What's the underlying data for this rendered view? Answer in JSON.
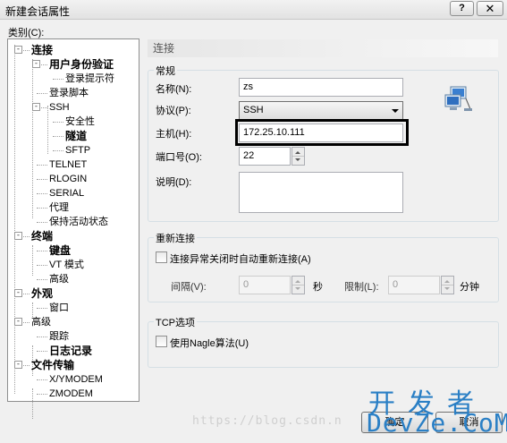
{
  "window": {
    "title": "新建会话属性",
    "help_label": "?",
    "close_label": "✕"
  },
  "category_label": "类别(C):",
  "tree": [
    {
      "label": "连接",
      "bold": true,
      "level": 0,
      "expander": "-"
    },
    {
      "label": "用户身份验证",
      "bold": true,
      "level": 1,
      "expander": "-"
    },
    {
      "label": "登录提示符",
      "bold": false,
      "level": 2
    },
    {
      "label": "登录脚本",
      "bold": false,
      "level": 1
    },
    {
      "label": "SSH",
      "bold": false,
      "level": 1,
      "expander": "-"
    },
    {
      "label": "安全性",
      "bold": false,
      "level": 2
    },
    {
      "label": "隧道",
      "bold": true,
      "level": 2
    },
    {
      "label": "SFTP",
      "bold": false,
      "level": 2
    },
    {
      "label": "TELNET",
      "bold": false,
      "level": 1
    },
    {
      "label": "RLOGIN",
      "bold": false,
      "level": 1
    },
    {
      "label": "SERIAL",
      "bold": false,
      "level": 1
    },
    {
      "label": "代理",
      "bold": false,
      "level": 1
    },
    {
      "label": "保持活动状态",
      "bold": false,
      "level": 1
    },
    {
      "label": "终端",
      "bold": true,
      "level": 0,
      "expander": "-"
    },
    {
      "label": "键盘",
      "bold": true,
      "level": 1
    },
    {
      "label": "VT 模式",
      "bold": false,
      "level": 1
    },
    {
      "label": "高级",
      "bold": false,
      "level": 1
    },
    {
      "label": "外观",
      "bold": true,
      "level": 0,
      "expander": "-"
    },
    {
      "label": "窗口",
      "bold": false,
      "level": 1
    },
    {
      "label": "高级",
      "bold": false,
      "level": 0,
      "expander": "-"
    },
    {
      "label": "跟踪",
      "bold": false,
      "level": 1
    },
    {
      "label": "日志记录",
      "bold": true,
      "level": 1
    },
    {
      "label": "文件传输",
      "bold": true,
      "level": 0,
      "expander": "-"
    },
    {
      "label": "X/YMODEM",
      "bold": false,
      "level": 1
    },
    {
      "label": "ZMODEM",
      "bold": false,
      "level": 1
    }
  ],
  "panel": {
    "header": "连接",
    "general": {
      "title": "常规",
      "name_label": "名称(N):",
      "name_value": "zs",
      "protocol_label": "协议(P):",
      "protocol_value": "SSH",
      "host_label": "主机(H):",
      "host_value": "172.25.10.111",
      "port_label": "端口号(O):",
      "port_value": "22",
      "desc_label": "说明(D):",
      "desc_value": ""
    },
    "reconnect": {
      "title": "重新连接",
      "auto_label": "连接异常关闭时自动重新连接(A)",
      "auto_checked": false,
      "interval_label": "间隔(V):",
      "interval_value": "0",
      "seconds_label": "秒",
      "limit_label": "限制(L):",
      "limit_value": "0",
      "minutes_label": "分钟"
    },
    "tcp": {
      "title": "TCP选项",
      "nagle_label": "使用Nagle算法(U)",
      "nagle_checked": false
    }
  },
  "buttons": {
    "ok": "确定",
    "cancel": "取消"
  },
  "watermark": {
    "url": "https://blog.csdn.n",
    "logo_cn": "开发者",
    "logo_en": "DevZe.CoM"
  }
}
